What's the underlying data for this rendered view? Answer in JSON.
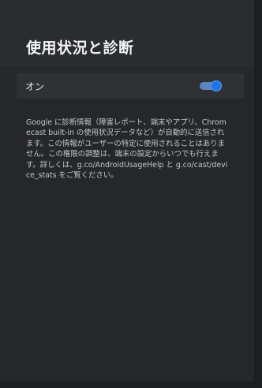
{
  "header": {
    "title": "使用状況と診断"
  },
  "setting": {
    "label": "オン",
    "enabled": true,
    "accent_color": "#1a73e8"
  },
  "description": {
    "text": "Google に診断情報（障害レポート、端末やアプリ、Chromecast built-in の使用状況データなど）が自動的に送信されます。この情報がユーザーの特定に使用されることはありません。この権限の調整は、端末の設定からいつでも行えます。詳しくは、g.co/AndroidUsageHelp と g.co/cast/device_stats をご覧ください。"
  }
}
